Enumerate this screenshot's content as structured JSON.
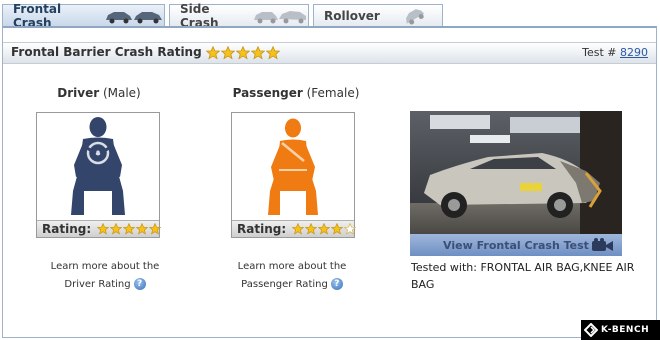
{
  "tabs": [
    {
      "label": "Frontal Crash",
      "active": true,
      "icon": "cars-collision-icon"
    },
    {
      "label": "Side Crash",
      "active": false,
      "icon": "side-impact-cars-icon"
    },
    {
      "label": "Rollover",
      "active": false,
      "icon": "rollover-car-icon"
    }
  ],
  "panel": {
    "title": "Frontal Barrier Crash Rating",
    "overall_stars": 5,
    "test_prefix": "Test #",
    "test_number": "8290"
  },
  "driver": {
    "title": "Driver",
    "subtitle": "(Male)",
    "rating_label": "Rating:",
    "stars": 5,
    "learn_line1": "Learn more about the",
    "learn_line2": "Driver Rating",
    "figure_color": "#34456b"
  },
  "passenger": {
    "title": "Passenger",
    "subtitle": "(Female)",
    "rating_label": "Rating:",
    "stars": 4,
    "learn_line1": "Learn more about the",
    "learn_line2": "Passenger Rating",
    "figure_color": "#f07b12"
  },
  "video": {
    "button_label": "View Frontal Crash Test",
    "tested_with": "Tested with: FRONTAL AIR BAG,KNEE AIR BAG"
  },
  "colors": {
    "star_fill": "#f5c21a",
    "accent": "#2a59a8",
    "tab_border": "#9fb2c8"
  },
  "logo": {
    "text": "K-BENCH"
  }
}
